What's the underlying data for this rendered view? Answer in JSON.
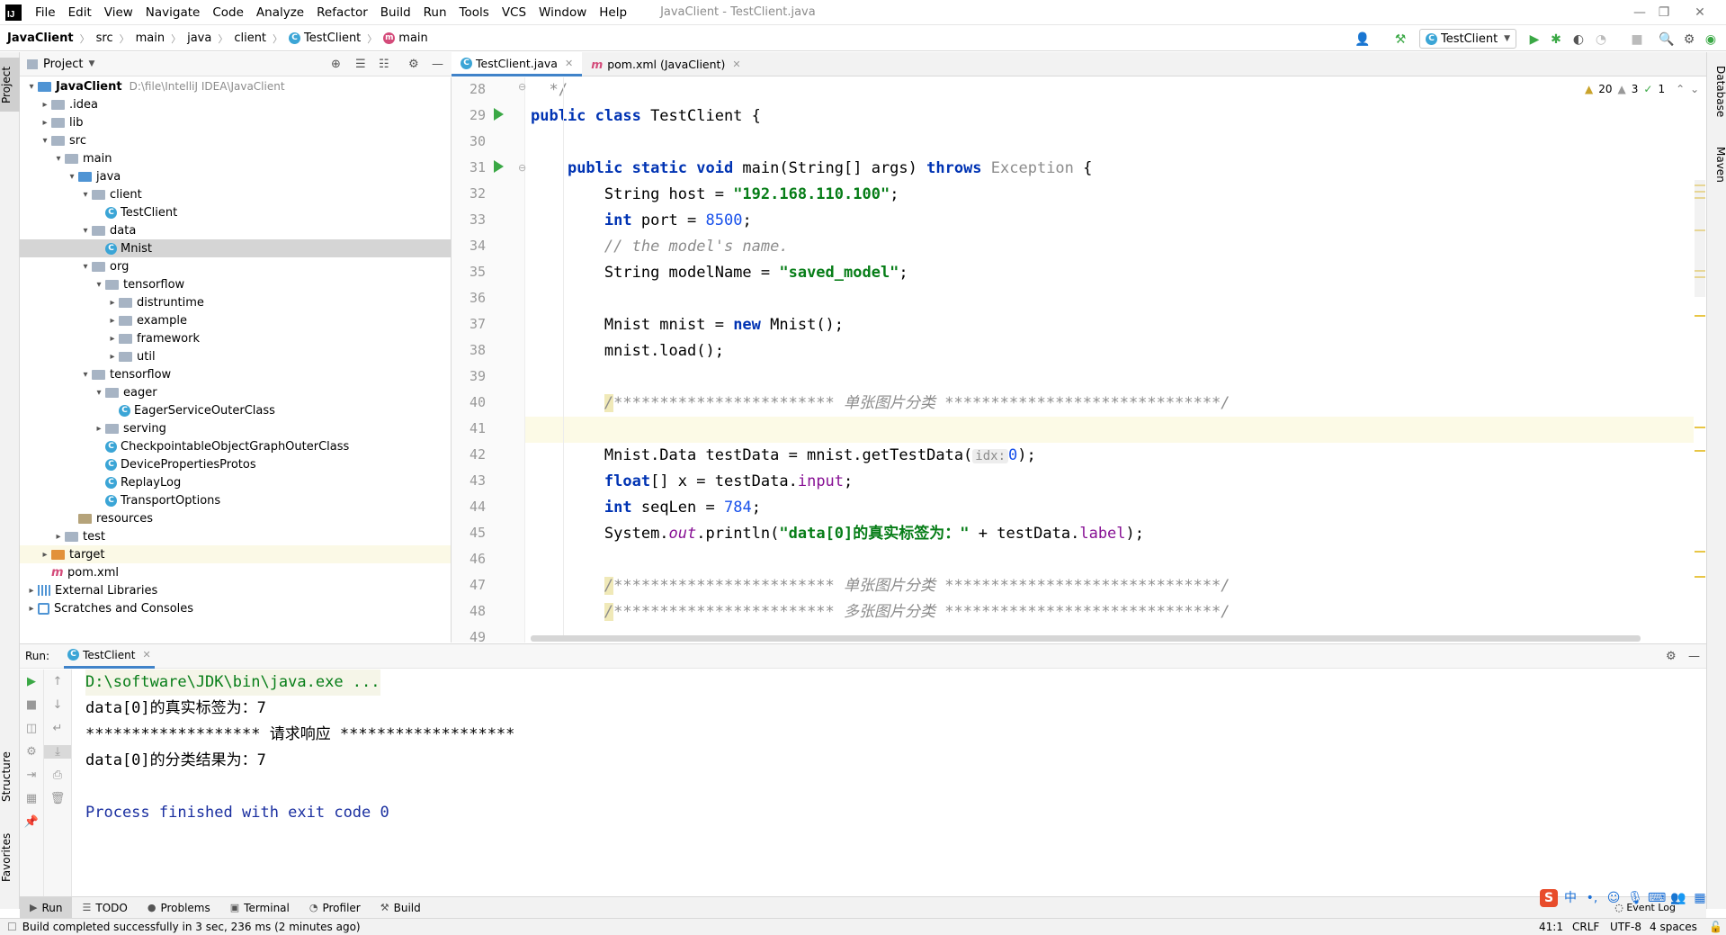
{
  "menu": {
    "items": [
      "File",
      "Edit",
      "View",
      "Navigate",
      "Code",
      "Analyze",
      "Refactor",
      "Build",
      "Run",
      "Tools",
      "VCS",
      "Window",
      "Help"
    ],
    "window_title": "JavaClient - TestClient.java"
  },
  "navbar": {
    "crumbs": [
      "JavaClient",
      "src",
      "main",
      "java",
      "client",
      "TestClient",
      "main"
    ],
    "run_config": "TestClient"
  },
  "sidebars": {
    "left": [
      "Project",
      "Structure",
      "Favorites"
    ],
    "right": [
      "Database",
      "Maven"
    ]
  },
  "project": {
    "header": "Project",
    "tree": [
      {
        "label": "JavaClient",
        "extra": "D:\\file\\IntelliJ IDEA\\JavaClient",
        "depth": 0,
        "arrow": "▾",
        "icon": "folder-blue",
        "bold": true
      },
      {
        "label": ".idea",
        "depth": 1,
        "arrow": "▸",
        "icon": "folder"
      },
      {
        "label": "lib",
        "depth": 1,
        "arrow": "▸",
        "icon": "folder"
      },
      {
        "label": "src",
        "depth": 1,
        "arrow": "▾",
        "icon": "folder"
      },
      {
        "label": "main",
        "depth": 2,
        "arrow": "▾",
        "icon": "folder"
      },
      {
        "label": "java",
        "depth": 3,
        "arrow": "▾",
        "icon": "folder-blue"
      },
      {
        "label": "client",
        "depth": 4,
        "arrow": "▾",
        "icon": "folder"
      },
      {
        "label": "TestClient",
        "depth": 5,
        "arrow": "",
        "icon": "class"
      },
      {
        "label": "data",
        "depth": 4,
        "arrow": "▾",
        "icon": "folder"
      },
      {
        "label": "Mnist",
        "depth": 5,
        "arrow": "",
        "icon": "class",
        "selected": true
      },
      {
        "label": "org",
        "depth": 4,
        "arrow": "▾",
        "icon": "folder"
      },
      {
        "label": "tensorflow",
        "depth": 5,
        "arrow": "▾",
        "icon": "folder"
      },
      {
        "label": "distruntime",
        "depth": 6,
        "arrow": "▸",
        "icon": "folder"
      },
      {
        "label": "example",
        "depth": 6,
        "arrow": "▸",
        "icon": "folder"
      },
      {
        "label": "framework",
        "depth": 6,
        "arrow": "▸",
        "icon": "folder"
      },
      {
        "label": "util",
        "depth": 6,
        "arrow": "▸",
        "icon": "folder"
      },
      {
        "label": "tensorflow",
        "depth": 4,
        "arrow": "▾",
        "icon": "folder"
      },
      {
        "label": "eager",
        "depth": 5,
        "arrow": "▾",
        "icon": "folder"
      },
      {
        "label": "EagerServiceOuterClass",
        "depth": 6,
        "arrow": "",
        "icon": "class"
      },
      {
        "label": "serving",
        "depth": 5,
        "arrow": "▸",
        "icon": "folder"
      },
      {
        "label": "CheckpointableObjectGraphOuterClass",
        "depth": 5,
        "arrow": "",
        "icon": "class"
      },
      {
        "label": "DevicePropertiesProtos",
        "depth": 5,
        "arrow": "",
        "icon": "class"
      },
      {
        "label": "ReplayLog",
        "depth": 5,
        "arrow": "",
        "icon": "class"
      },
      {
        "label": "TransportOptions",
        "depth": 5,
        "arrow": "",
        "icon": "class"
      },
      {
        "label": "resources",
        "depth": 3,
        "arrow": "",
        "icon": "folder-res"
      },
      {
        "label": "test",
        "depth": 2,
        "arrow": "▸",
        "icon": "folder"
      },
      {
        "label": "target",
        "depth": 1,
        "arrow": "▸",
        "icon": "folder-orange",
        "highlight": true
      },
      {
        "label": "pom.xml",
        "depth": 1,
        "arrow": "",
        "icon": "maven"
      },
      {
        "label": "External Libraries",
        "depth": 0,
        "arrow": "▸",
        "icon": "lib"
      },
      {
        "label": "Scratches and Consoles",
        "depth": 0,
        "arrow": "▸",
        "icon": "scratch"
      }
    ]
  },
  "editor": {
    "tabs": [
      {
        "label": "TestClient.java",
        "icon": "class",
        "active": true
      },
      {
        "label": "pom.xml (JavaClient)",
        "icon": "maven",
        "active": false
      }
    ],
    "inspections": {
      "warnings": "20",
      "weak_warnings": "3",
      "ok": "1"
    },
    "line_numbers": [
      "28",
      "29",
      "30",
      "31",
      "32",
      "33",
      "34",
      "35",
      "36",
      "37",
      "38",
      "39",
      "40",
      "41",
      "42",
      "43",
      "44",
      "45",
      "46",
      "47",
      "48",
      "49"
    ],
    "code": {
      "l28": "*/",
      "l29_kw": "public class",
      "l29_rest": " TestClient {",
      "l31_kw": "public static void",
      "l31_mid": " main(String[] args) ",
      "l31_kw2": "throws",
      "l31_exc": " Exception",
      "l31_end": " {",
      "l32_a": "String host = ",
      "l32_str": "\"192.168.110.100\"",
      "l32_b": ";",
      "l33_kw": "int",
      "l33_a": " port = ",
      "l33_num": "8500",
      "l33_b": ";",
      "l34": "// the model's name.",
      "l35_a": "String modelName = ",
      "l35_str": "\"saved_model\"",
      "l35_b": ";",
      "l37_a": "Mnist mnist = ",
      "l37_kw": "new",
      "l37_b": " Mnist();",
      "l38": "mnist.load();",
      "l40_first": "/",
      "l40_rest": "************************ 单张图片分类 ******************************/",
      "l42_a": "Mnist.Data testData = mnist.getTestData(",
      "l42_hint": "idx:",
      "l42_num": "0",
      "l42_b": ");",
      "l43_kw": "float",
      "l43_a": "[] x = testData.",
      "l43_fld": "input",
      "l43_b": ";",
      "l44_kw": "int",
      "l44_a": " seqLen = ",
      "l44_num": "784",
      "l44_b": ";",
      "l45_a": "System.",
      "l45_out": "out",
      "l45_b": ".println(",
      "l45_str": "\"data[0]的真实标签为：\"",
      "l45_c": " + testData.",
      "l45_fld": "label",
      "l45_d": ");",
      "l47_first": "/",
      "l47_rest": "************************ 单张图片分类 ******************************/",
      "l48_first": "/",
      "l48_rest": "************************ 多张图片分类 ******************************/"
    }
  },
  "run": {
    "label": "Run:",
    "tab": "TestClient",
    "console": [
      "D:\\software\\JDK\\bin\\java.exe ...",
      "data[0]的真实标签为：7",
      "******************* 请求响应 *******************",
      "data[0]的分类结果为：7",
      "",
      "Process finished with exit code 0"
    ]
  },
  "bottom_tools": [
    "Run",
    "TODO",
    "Problems",
    "Terminal",
    "Profiler",
    "Build"
  ],
  "status": {
    "message": "Build completed successfully in 3 sec, 236 ms (2 minutes ago)",
    "position": "41:1",
    "line_sep": "CRLF",
    "encoding": "UTF-8",
    "indent": "4 spaces",
    "event_log": "Event Log"
  },
  "ime": {
    "lang": "中"
  },
  "colors": {
    "accent": "#4083c9",
    "keyword": "#0033b3",
    "string": "#067d17",
    "number": "#1750eb",
    "run_green": "#3aa845"
  }
}
